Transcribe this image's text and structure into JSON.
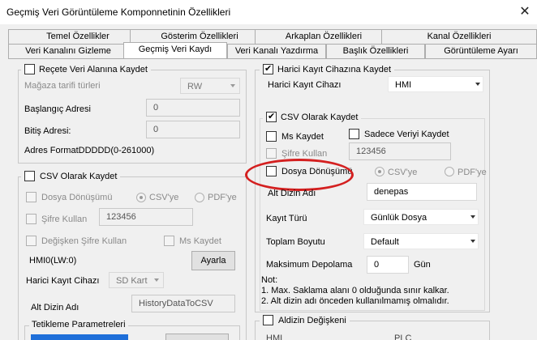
{
  "window": {
    "title": "Geçmiş Veri Görüntüleme Komponnetinin Özellikleri",
    "close_glyph": "✕"
  },
  "tabs_row1": [
    "Temel Özellikler",
    "Gösterim Özellikleri",
    "Arkaplan Özellikleri",
    "Kanal Özellikleri"
  ],
  "tabs_row2": [
    "Veri Kanalını Gizleme",
    "Geçmiş Veri Kaydı",
    "Veri Kanalı Yazdırma",
    "Başlık Özellikleri",
    "Görüntüleme Ayarı"
  ],
  "left": {
    "recipe": {
      "checkbox_label": "Reçete Veri Alanına Kaydet",
      "store_type_label": "Mağaza tarifi türleri",
      "store_type_value": "RW",
      "start_addr_label": "Başlangıç Adresi",
      "start_addr_value": "0",
      "bit_addr_label": "Bitiş Adresi:",
      "bit_addr_value": "0",
      "addr_format": "Adres FormatDDDDD(0-261000)"
    },
    "csv": {
      "checkbox_label": "CSV Olarak Kaydet",
      "file_conv_label": "Dosya Dönüşümü",
      "csv_radio": "CSV'ye",
      "pdf_radio": "PDF'ye",
      "password_label": "Şifre Kullan",
      "password_value": "123456",
      "change_pw_label": "Değişken Şifre Kullan",
      "ms_save_label": "Ms Kaydet",
      "hmi_value": "HMI0(LW:0)",
      "adjust_button": "Ayarla",
      "ext_device_label": "Harici Kayıt Cihazı",
      "ext_device_value": "SD Kart",
      "subdir_label": "Alt Dizin Adı",
      "subdir_value": "HistoryDataToCSV",
      "trigger_label": "Tetikleme Parametreleri"
    }
  },
  "right": {
    "ext_save_label": "Harici Kayıt Cihazına Kaydet",
    "ext_device_label": "Harici Kayıt Cihazı",
    "ext_device_value": "HMI",
    "csv_label": "CSV Olarak Kaydet",
    "ms_save_label": "Ms Kaydet",
    "only_data_label": "Sadece Veriyi Kaydet",
    "password_label": "Şifre Kullan",
    "password_value": "123456",
    "file_conv_label": "Dosya Dönüşümü",
    "csv_radio": "CSV'ye",
    "pdf_radio": "PDF'ye",
    "subdir_label": "Alt Dizin Adı",
    "subdir_value": "denepas",
    "record_type_label": "Kayıt Türü",
    "record_type_value": "Günlük Dosya",
    "total_size_label": "Toplam Boyutu",
    "total_size_value": "Default",
    "max_storage_label": "Maksimum Depolama",
    "max_storage_value": "0",
    "max_storage_unit": "Gün",
    "note_title": "Not:",
    "note_1": "1. Max. Saklama alanı 0 olduğunda sınır kalkar.",
    "note_2": "2. Alt dizin adı önceden kullanılmamış olmalıdır.",
    "subfolder_var_label": "Aldizin Değişkeni",
    "bottom_hmi": "HMI",
    "bottom_plc": "PLC"
  },
  "colors": {
    "highlight": "#d42020",
    "window_bg": "#f0f0f0"
  }
}
